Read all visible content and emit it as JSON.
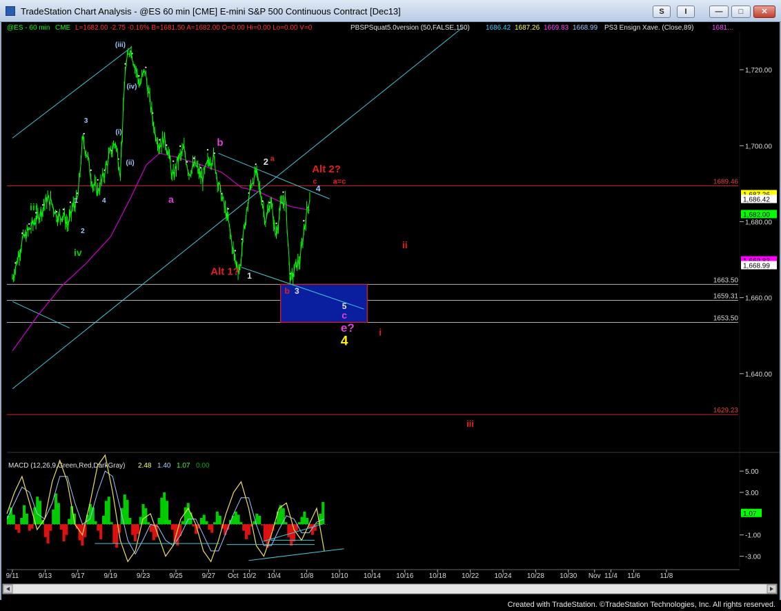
{
  "window": {
    "title": "TradeStation Chart Analysis - @ES 60 min [CME] E-mini S&P 500 Continuous Contract [Dec13]",
    "buttons": [
      "S",
      "I"
    ],
    "footer": "Created with TradeStation. ©TradeStation Technologies, Inc. All rights reserved."
  },
  "colors": {
    "price": "#00ff00",
    "ma": "#c000c0",
    "channel": "#40c8d8",
    "level_line": "#d02020",
    "box_fill": "#0a1ea0",
    "box_border": "#e02020",
    "macd_up": "#00cc00",
    "macd_down": "#dd1111",
    "macd_line": "#f0e060",
    "signal_line": "#a0c8ff"
  },
  "header": {
    "symbol": "@ES - 60 min",
    "exchange": "CME",
    "stats": "L=1682.00  -2.75  -0.16%  B=1681.50  A=1682.00  O=0.00  Hi=0.00  Lo=0.00  V=0",
    "indicator": "PBSPSquat5.0version (50,FALSE,150)",
    "indicator_values": [
      "1686.42",
      "1687.26",
      "1669.83",
      "1668.99"
    ],
    "ensign": "PS3 Ensign Xave. (Close,89)",
    "ensign_value": "1681..."
  },
  "chart_data": {
    "type": "line",
    "title": "@ES 60 min [CME] E-mini S&P 500 Continuous Contract [Dec13]",
    "x_tick_labels": [
      "9/11",
      "9/13",
      "9/17",
      "9/19",
      "9/23",
      "9/25",
      "9/27",
      "Oct",
      "10/2",
      "10/4",
      "10/8",
      "10/10",
      "10/14",
      "10/16",
      "10/18",
      "10/22",
      "10/24",
      "10/28",
      "10/30",
      "Nov",
      "11/4",
      "11/6",
      "11/8"
    ],
    "x_tick_index": [
      0,
      2,
      4,
      6,
      8,
      10,
      12,
      13.5,
      14.5,
      16,
      18,
      20,
      22,
      24,
      26,
      28,
      30,
      32,
      34,
      35.6,
      36.6,
      38,
      40
    ],
    "ylim": [
      1620,
      1730
    ],
    "y_ticks": [
      1640,
      1660,
      1680,
      1700,
      1720
    ],
    "y_tick_labels": [
      "1,640.00",
      "1,660.00",
      "1,680.00",
      "1,700.00",
      "1,720.00"
    ],
    "price_series": {
      "name": "@ES 60 min",
      "points": [
        [
          0,
          1665
        ],
        [
          0.6,
          1675
        ],
        [
          1.2,
          1679
        ],
        [
          1.8,
          1683
        ],
        [
          2.1,
          1686
        ],
        [
          2.4,
          1685
        ],
        [
          2.8,
          1681
        ],
        [
          3.1,
          1682
        ],
        [
          3.4,
          1679
        ],
        [
          3.7,
          1684
        ],
        [
          4.0,
          1686
        ],
        [
          4.3,
          1702
        ],
        [
          4.6,
          1697
        ],
        [
          4.9,
          1690
        ],
        [
          5.2,
          1688
        ],
        [
          5.5,
          1691
        ],
        [
          5.9,
          1697
        ],
        [
          6.3,
          1701
        ],
        [
          6.6,
          1693
        ],
        [
          6.9,
          1720
        ],
        [
          7.2,
          1726
        ],
        [
          7.5,
          1721
        ],
        [
          7.8,
          1716
        ],
        [
          8.1,
          1720
        ],
        [
          8.4,
          1712
        ],
        [
          8.7,
          1704
        ],
        [
          9.0,
          1700
        ],
        [
          9.3,
          1702
        ],
        [
          9.6,
          1697
        ],
        [
          9.8,
          1691
        ],
        [
          10.1,
          1696
        ],
        [
          10.5,
          1699
        ],
        [
          10.8,
          1693
        ],
        [
          11.2,
          1695
        ],
        [
          11.6,
          1691
        ],
        [
          12.0,
          1696
        ],
        [
          12.3,
          1697
        ],
        [
          12.6,
          1690
        ],
        [
          12.9,
          1685
        ],
        [
          13.2,
          1680
        ],
        [
          13.6,
          1670
        ],
        [
          13.9,
          1667
        ],
        [
          14.2,
          1679
        ],
        [
          14.6,
          1690
        ],
        [
          14.9,
          1693
        ],
        [
          15.2,
          1687
        ],
        [
          15.5,
          1680
        ],
        [
          15.8,
          1686
        ],
        [
          16.1,
          1676
        ],
        [
          16.4,
          1684
        ],
        [
          16.7,
          1686
        ],
        [
          17.0,
          1664
        ],
        [
          17.3,
          1668
        ],
        [
          17.6,
          1670
        ],
        [
          17.9,
          1680
        ],
        [
          18.2,
          1687
        ]
      ]
    },
    "ma_series": {
      "name": "PS3 Ensign Xave. (Close,89)",
      "points": [
        [
          0,
          1646
        ],
        [
          1.5,
          1655
        ],
        [
          3,
          1663
        ],
        [
          4.5,
          1669
        ],
        [
          6,
          1676
        ],
        [
          7.2,
          1686
        ],
        [
          8.2,
          1695
        ],
        [
          9.0,
          1698
        ],
        [
          10.0,
          1697
        ],
        [
          11.5,
          1695
        ],
        [
          12.8,
          1693
        ],
        [
          14.0,
          1689
        ],
        [
          15.0,
          1688
        ],
        [
          16.0,
          1686
        ],
        [
          17.0,
          1684
        ],
        [
          18.2,
          1683
        ]
      ]
    },
    "channel_lines": [
      {
        "from": [
          0,
          1702
        ],
        "to": [
          7.3,
          1726
        ]
      },
      {
        "from": [
          0,
          1636
        ],
        "to": [
          27.5,
          1731
        ]
      },
      {
        "from": [
          0,
          1659
        ],
        "to": [
          3.5,
          1652
        ]
      },
      {
        "from": [
          12.6,
          1698
        ],
        "to": [
          19.4,
          1686
        ]
      },
      {
        "from": [
          14.0,
          1668
        ],
        "to": [
          21.5,
          1657
        ]
      }
    ],
    "horizontal_levels": [
      {
        "value": 1689.46,
        "label": "1689.46",
        "color": "#d02020"
      },
      {
        "value": 1663.5,
        "label": "1663.50",
        "color": "#b0b0b0"
      },
      {
        "value": 1659.31,
        "label": "1659.31",
        "color": "#b0b0b0"
      },
      {
        "value": 1653.5,
        "label": "1653.50",
        "color": "#b0b0b0"
      },
      {
        "value": 1629.23,
        "label": "1629.23",
        "color": "#d02020"
      }
    ],
    "target_box": {
      "x0": 16.4,
      "x1": 21.7,
      "y0": 1653.5,
      "y1": 1663.5
    },
    "right_price_badges": [
      {
        "value": 1687.26,
        "label": "1,687.26",
        "bg": "#ffff00",
        "fg": "#000"
      },
      {
        "value": 1686.42,
        "label": "1,686.42",
        "bg": "#ffffff",
        "fg": "#000"
      },
      {
        "value": 1682.0,
        "label": "1,682.00",
        "bg": "#00ff00",
        "fg": "#000"
      },
      {
        "value": 1669.83,
        "label": "1,669.83",
        "bg": "#ff00ff",
        "fg": "#000"
      },
      {
        "value": 1668.99,
        "label": "1,668.99",
        "bg": "#ffffff",
        "fg": "#000"
      }
    ],
    "wave_labels": [
      {
        "x": 6.6,
        "y": 1726,
        "text": "(iii)",
        "color": "#a0c8ff",
        "size": 10
      },
      {
        "x": 7.3,
        "y": 1715,
        "text": "(iv)",
        "color": "#a0c8ff",
        "size": 10
      },
      {
        "x": 6.5,
        "y": 1703,
        "text": "(i)",
        "color": "#a0c8ff",
        "size": 10
      },
      {
        "x": 7.2,
        "y": 1695,
        "text": "(ii)",
        "color": "#a0c8ff",
        "size": 10
      },
      {
        "x": 4.5,
        "y": 1706,
        "text": "3",
        "color": "#a0c8ff",
        "size": 10
      },
      {
        "x": 5.6,
        "y": 1685,
        "text": "4",
        "color": "#a0c8ff",
        "size": 10
      },
      {
        "x": 3.9,
        "y": 1685,
        "text": "1",
        "color": "#a0c8ff",
        "size": 10
      },
      {
        "x": 4.3,
        "y": 1677,
        "text": "2",
        "color": "#a0c8ff",
        "size": 10
      },
      {
        "x": 1.3,
        "y": 1683,
        "text": "iii",
        "color": "#00cc00",
        "size": 14
      },
      {
        "x": 4.0,
        "y": 1671,
        "text": "iv",
        "color": "#00cc00",
        "size": 14
      },
      {
        "x": 12.7,
        "y": 1700,
        "text": "b",
        "color": "#e040e0",
        "size": 15
      },
      {
        "x": 9.7,
        "y": 1685,
        "text": "a",
        "color": "#e040e0",
        "size": 14
      },
      {
        "x": 15.5,
        "y": 1695,
        "text": "2",
        "color": "#e0e0e0",
        "size": 13
      },
      {
        "x": 15.9,
        "y": 1696,
        "text": "a",
        "color": "#e02020",
        "size": 11
      },
      {
        "x": 19.2,
        "y": 1693,
        "text": "Alt 2?",
        "color": "#e02020",
        "size": 15
      },
      {
        "x": 18.5,
        "y": 1690,
        "text": "c",
        "color": "#e02020",
        "size": 11
      },
      {
        "x": 20.0,
        "y": 1690,
        "text": "a=c",
        "color": "#e02020",
        "size": 11
      },
      {
        "x": 18.7,
        "y": 1688,
        "text": "4",
        "color": "#a0c8ff",
        "size": 12
      },
      {
        "x": 24.0,
        "y": 1673,
        "text": "ii",
        "color": "#e02020",
        "size": 14
      },
      {
        "x": 13.0,
        "y": 1666,
        "text": "Alt 1?",
        "color": "#e02020",
        "size": 15
      },
      {
        "x": 14.5,
        "y": 1665,
        "text": "1",
        "color": "#e0e0e0",
        "size": 12
      },
      {
        "x": 16.8,
        "y": 1661,
        "text": "b",
        "color": "#e02020",
        "size": 12
      },
      {
        "x": 17.4,
        "y": 1661,
        "text": "3",
        "color": "#e0e0e0",
        "size": 12
      },
      {
        "x": 20.3,
        "y": 1657,
        "text": "5",
        "color": "#e0e0e0",
        "size": 12
      },
      {
        "x": 20.3,
        "y": 1654.5,
        "text": "c",
        "color": "#e040e0",
        "size": 14
      },
      {
        "x": 20.5,
        "y": 1651,
        "text": "e?",
        "color": "#e040e0",
        "size": 17
      },
      {
        "x": 20.3,
        "y": 1647.5,
        "text": "4",
        "color": "#ffee00",
        "size": 19
      },
      {
        "x": 22.5,
        "y": 1650,
        "text": "i",
        "color": "#e02020",
        "size": 14
      },
      {
        "x": 28.0,
        "y": 1626,
        "text": "iii",
        "color": "#e02020",
        "size": 13
      }
    ],
    "macd": {
      "label": "MACD (12,26,9,Green,Red,DarkGray)",
      "values": [
        "2.48",
        "1.40",
        "1.07",
        "0.00"
      ],
      "value_colors": [
        "#ffff60",
        "#a0d8ff",
        "#40ff40",
        "#00aa00"
      ],
      "ylim": [
        -4.0,
        6.5
      ],
      "y_ticks": [
        5,
        3,
        -1,
        -3
      ],
      "y_tick_labels": [
        "5.00",
        "3.00",
        "-1.00",
        "-3.00"
      ],
      "current_badge": {
        "value": 1.07,
        "label": "1.07"
      },
      "histogram": [
        0.8,
        1.6,
        0.9,
        -0.5,
        -0.8,
        0.6,
        1.8,
        1.0,
        -0.6,
        -0.4,
        1.6,
        2.6,
        2.2,
        0.4,
        -1.2,
        -1.8,
        -0.6,
        1.4,
        2.9,
        2.0,
        -0.5,
        -1.6,
        -1.0,
        0.5,
        1.7,
        1.0,
        -0.4,
        -1.5,
        -2.0,
        -1.2,
        0.9,
        1.9,
        1.6,
        0.3,
        -0.6,
        -1.4,
        0.8,
        2.2,
        2.6,
        0.2,
        -1.8,
        -2.2,
        -0.8,
        1.5,
        2.8,
        2.3,
        0.6,
        -1.0,
        -1.6,
        -0.9,
        0.7,
        1.9,
        1.5,
        0.2,
        -0.7,
        -1.5,
        -1.2,
        0.6,
        2.5,
        3.0,
        2.2,
        0.4,
        -0.5,
        -1.6,
        -2.0,
        -1.1,
        0.3,
        1.6,
        2.0,
        1.1,
        -0.2,
        -0.9,
        -0.4,
        0.6,
        0.9,
        0.3,
        -0.5,
        -0.8,
        0.2,
        1.2,
        0.8,
        -0.4,
        -1.0,
        -0.5,
        0.4,
        0.8,
        1.2,
        0.9,
        0.2,
        -0.6,
        -1.4,
        -1.0,
        -0.2,
        0.3,
        1.0,
        0.8,
        -0.1,
        -1.6,
        -2.2,
        -1.4,
        -0.6,
        0.2,
        1.2,
        1.8,
        1.5,
        0.2,
        -1.2,
        -2.0,
        -1.6,
        -0.6,
        0.2,
        0.7,
        1.2,
        0.6,
        -0.4,
        -1.0,
        -0.6,
        0.1,
        1.0,
        2.1
      ],
      "macd_line": [
        1,
        3,
        4.5,
        2,
        -0.5,
        0.5,
        4,
        6,
        4,
        0,
        -1,
        2,
        5.5,
        6.5,
        3,
        -1.5,
        -3.5,
        -2.5,
        0.5,
        1,
        -1,
        -3,
        -2,
        0.5,
        1.5,
        0,
        -2.5,
        -3.5,
        -1.5,
        1,
        3,
        4,
        1.5,
        -2,
        -3,
        -1,
        1.5,
        2,
        -0.5,
        -1.5,
        0,
        1.5,
        -2.5
      ],
      "signal_line": [
        0.5,
        2,
        3.5,
        3,
        1,
        0.5,
        2,
        4.5,
        4.5,
        2,
        0,
        0.5,
        3,
        5,
        4.5,
        1.5,
        -1.5,
        -2.8,
        -1.5,
        0,
        -0.2,
        -1.5,
        -2,
        -1,
        0.5,
        0.5,
        -1,
        -2.5,
        -2.5,
        -0.8,
        1,
        2.5,
        2.5,
        0,
        -2,
        -2,
        -0.5,
        0.8,
        0.5,
        -0.8,
        -0.8,
        0.2,
        0.5
      ],
      "trend_lines": [
        {
          "from": [
            0.12,
            -1.8
          ],
          "to": [
            0.29,
            -1.8
          ]
        },
        {
          "from": [
            0.3,
            -1.9
          ],
          "to": [
            0.42,
            -1.9
          ]
        },
        {
          "from": [
            0.36,
            -1.5
          ],
          "to": [
            0.42,
            -1.5
          ]
        },
        {
          "from": [
            0.33,
            -3.4
          ],
          "to": [
            0.46,
            -2.3
          ]
        },
        {
          "from": [
            0.35,
            -1.6
          ],
          "to": [
            0.43,
            0.0
          ]
        }
      ]
    }
  }
}
